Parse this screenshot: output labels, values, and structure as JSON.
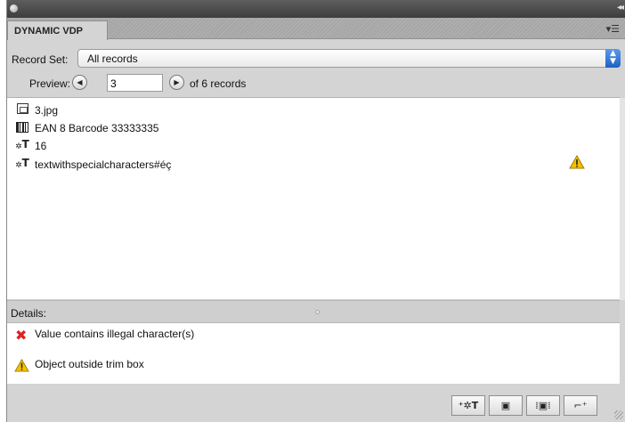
{
  "panel": {
    "tab_label": "DYNAMIC VDP",
    "menu_icon": "panel-menu-icon",
    "collapse_icon": "collapse-icon"
  },
  "record_set": {
    "label": "Record Set:",
    "selected": "All records"
  },
  "preview": {
    "label": "Preview:",
    "value": "3",
    "of_text": "of 6 records"
  },
  "items": [
    {
      "icon": "image-icon",
      "text": "3.jpg",
      "warning": false
    },
    {
      "icon": "barcode-icon",
      "text": "EAN 8  Barcode 33333335",
      "warning": false
    },
    {
      "icon": "variable-text-icon",
      "text": "16",
      "warning": false
    },
    {
      "icon": "variable-text-icon",
      "text": "textwithspecialcharacters#éç",
      "warning": true
    }
  ],
  "details": {
    "label": "Details:",
    "messages": [
      {
        "icon": "error-x-icon",
        "text": "Value contains illegal character(s)"
      },
      {
        "icon": "warning-icon",
        "text": "Object outside trim box"
      }
    ]
  },
  "toolbar": {
    "buttons": [
      "add-variable-text-icon",
      "record-icon",
      "fit-frame-icon",
      "add-frame-icon"
    ]
  },
  "colors": {
    "accent": "#2a6fd6",
    "warning": "#f2c200",
    "error": "#d22222"
  }
}
